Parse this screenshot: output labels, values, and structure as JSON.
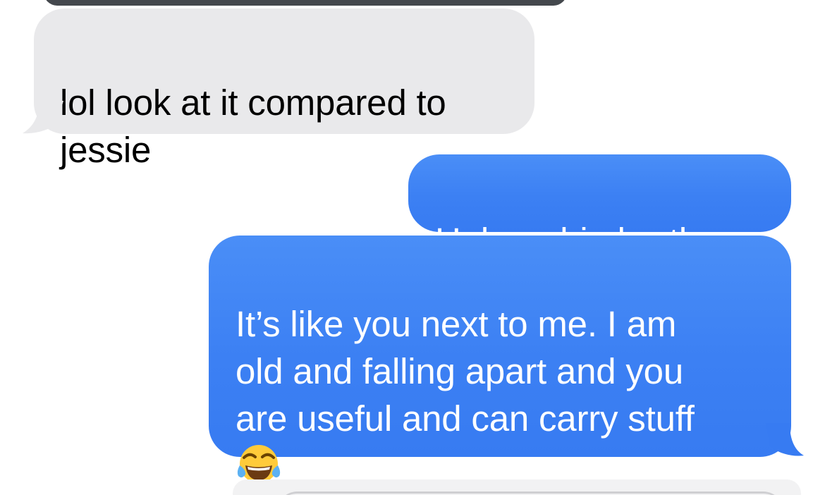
{
  "messages": [
    {
      "direction": "received",
      "text": "lol look at it compared to\njessie",
      "bubble_color": "#e9e9eb",
      "text_color": "#000000"
    },
    {
      "direction": "sent",
      "text": "Haha a big brother",
      "bubble_color": "#3b82f6",
      "text_color": "#ffffff"
    },
    {
      "direction": "sent",
      "text": "It’s like you next to me. I am\nold and falling apart and you\nare useful and can carry stuff",
      "emoji": "face-with-tears-of-joy-icon",
      "bubble_color": "#3b82f6",
      "text_color": "#ffffff"
    }
  ]
}
